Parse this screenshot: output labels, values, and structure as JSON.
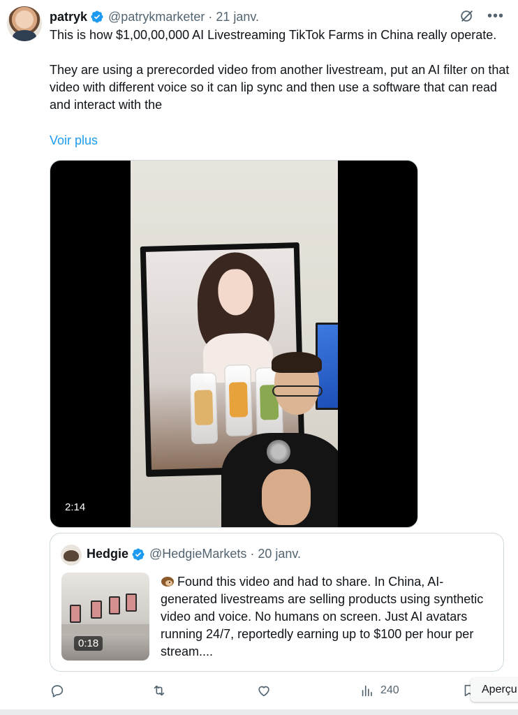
{
  "tweet": {
    "author": {
      "display_name": "patryk",
      "handle": "@patrykmarketer",
      "date": "21 janv.",
      "separator": "·"
    },
    "text_paragraphs": [
      "This is how $1,00,00,000 AI Livestreaming TikTok Farms in China really operate.",
      "They are using a prerecorded video from another livestream, put an AI filter on that video with different voice so it can lip sync and then use a software that can read and interact with the"
    ],
    "show_more": "Voir plus",
    "video": {
      "duration": "2:14"
    }
  },
  "quote": {
    "author": {
      "display_name": "Hedgie",
      "handle": "@HedgieMarkets",
      "date": "20 janv.",
      "separator": "·"
    },
    "text": "Found this video and had to share. In China, AI-generated livestreams are selling products using synthetic video and voice. No humans on screen. Just AI avatars running 24/7, reportedly earning up to $100 per hour per stream....",
    "video_duration": "0:18"
  },
  "actions": {
    "views": "240",
    "tooltip": "Aperçu"
  },
  "icons": {
    "verified": "verified-badge-icon",
    "grok": "grok-icon",
    "more": "more-icon",
    "reply": "reply-icon",
    "retweet": "retweet-icon",
    "like": "like-icon",
    "views": "views-icon",
    "bookmark": "bookmark-icon"
  },
  "colors": {
    "accent": "#1d9bf0",
    "text": "#0f1419",
    "muted": "#536471",
    "border": "#cfd9de"
  }
}
